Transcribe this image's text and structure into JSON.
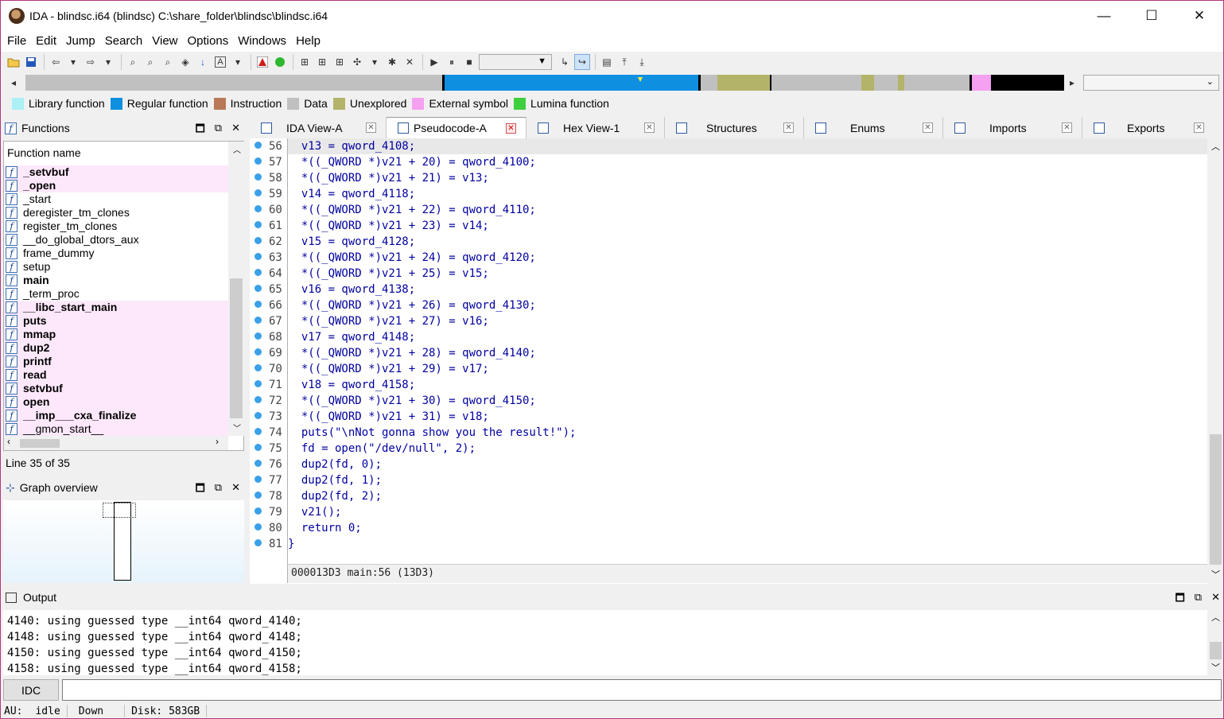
{
  "window": {
    "title": "IDA - blindsc.i64 (blindsc) C:\\share_folder\\blindsc\\blindsc.i64",
    "minimize": "—",
    "maximize": "☐",
    "close": "✕"
  },
  "menu": [
    "File",
    "Edit",
    "Jump",
    "Search",
    "View",
    "Options",
    "Windows",
    "Help"
  ],
  "legend": [
    {
      "label": "Library function",
      "color": "#aaf0f5"
    },
    {
      "label": "Regular function",
      "color": "#0e8fe0"
    },
    {
      "label": "Instruction",
      "color": "#b97956"
    },
    {
      "label": "Data",
      "color": "#c0c0c0"
    },
    {
      "label": "Unexplored",
      "color": "#b3b46a"
    },
    {
      "label": "External symbol",
      "color": "#f5a0f0"
    },
    {
      "label": "Lumina function",
      "color": "#3ecf3e"
    }
  ],
  "functions": {
    "title": "Functions",
    "header": "Function name",
    "items": [
      {
        "name": "_setvbuf",
        "bold": true,
        "pink": true
      },
      {
        "name": "_open",
        "bold": true,
        "pink": true
      },
      {
        "name": "_start",
        "bold": false,
        "pink": false
      },
      {
        "name": "deregister_tm_clones",
        "bold": false,
        "pink": false
      },
      {
        "name": "register_tm_clones",
        "bold": false,
        "pink": false
      },
      {
        "name": "__do_global_dtors_aux",
        "bold": false,
        "pink": false
      },
      {
        "name": "frame_dummy",
        "bold": false,
        "pink": false
      },
      {
        "name": "setup",
        "bold": false,
        "pink": false
      },
      {
        "name": "main",
        "bold": true,
        "pink": false
      },
      {
        "name": "_term_proc",
        "bold": false,
        "pink": false
      },
      {
        "name": "__libc_start_main",
        "bold": true,
        "pink": true
      },
      {
        "name": "puts",
        "bold": true,
        "pink": true
      },
      {
        "name": "mmap",
        "bold": true,
        "pink": true
      },
      {
        "name": "dup2",
        "bold": true,
        "pink": true
      },
      {
        "name": "printf",
        "bold": true,
        "pink": true
      },
      {
        "name": "read",
        "bold": true,
        "pink": true
      },
      {
        "name": "setvbuf",
        "bold": true,
        "pink": true
      },
      {
        "name": "open",
        "bold": true,
        "pink": true
      },
      {
        "name": "__imp___cxa_finalize",
        "bold": true,
        "pink": true
      },
      {
        "name": "__gmon_start__",
        "bold": false,
        "pink": true
      }
    ],
    "status": "Line 35 of 35"
  },
  "graph_overview": {
    "title": "Graph overview"
  },
  "tabs": [
    {
      "label": "IDA View-A",
      "active": false
    },
    {
      "label": "Pseudocode-A",
      "active": true
    },
    {
      "label": "Hex View-1",
      "active": false
    },
    {
      "label": "Structures",
      "active": false
    },
    {
      "label": "Enums",
      "active": false
    },
    {
      "label": "Imports",
      "active": false
    },
    {
      "label": "Exports",
      "active": false
    }
  ],
  "code": {
    "lines": [
      {
        "n": "56",
        "text": "  v13 = qword_4108;"
      },
      {
        "n": "57",
        "text": "  *((_QWORD *)v21 + 20) = qword_4100;"
      },
      {
        "n": "58",
        "text": "  *((_QWORD *)v21 + 21) = v13;"
      },
      {
        "n": "59",
        "text": "  v14 = qword_4118;"
      },
      {
        "n": "60",
        "text": "  *((_QWORD *)v21 + 22) = qword_4110;"
      },
      {
        "n": "61",
        "text": "  *((_QWORD *)v21 + 23) = v14;"
      },
      {
        "n": "62",
        "text": "  v15 = qword_4128;"
      },
      {
        "n": "63",
        "text": "  *((_QWORD *)v21 + 24) = qword_4120;"
      },
      {
        "n": "64",
        "text": "  *((_QWORD *)v21 + 25) = v15;"
      },
      {
        "n": "65",
        "text": "  v16 = qword_4138;"
      },
      {
        "n": "66",
        "text": "  *((_QWORD *)v21 + 26) = qword_4130;"
      },
      {
        "n": "67",
        "text": "  *((_QWORD *)v21 + 27) = v16;"
      },
      {
        "n": "68",
        "text": "  v17 = qword_4148;"
      },
      {
        "n": "69",
        "text": "  *((_QWORD *)v21 + 28) = qword_4140;"
      },
      {
        "n": "70",
        "text": "  *((_QWORD *)v21 + 29) = v17;"
      },
      {
        "n": "71",
        "text": "  v18 = qword_4158;"
      },
      {
        "n": "72",
        "text": "  *((_QWORD *)v21 + 30) = qword_4150;"
      },
      {
        "n": "73",
        "text": "  *((_QWORD *)v21 + 31) = v18;"
      },
      {
        "n": "74",
        "text": "  puts(\"\\nNot gonna show you the result!\");"
      },
      {
        "n": "75",
        "text": "  fd = open(\"/dev/null\", 2);"
      },
      {
        "n": "76",
        "text": "  dup2(fd, 0);"
      },
      {
        "n": "77",
        "text": "  dup2(fd, 1);"
      },
      {
        "n": "78",
        "text": "  dup2(fd, 2);"
      },
      {
        "n": "79",
        "text": "  v21();"
      },
      {
        "n": "80",
        "text": "  return 0;"
      },
      {
        "n": "81",
        "text": "}"
      }
    ],
    "status": "000013D3 main:56 (13D3)"
  },
  "output": {
    "title": "Output",
    "lines": [
      "4140: using guessed type __int64 qword_4140;",
      "4148: using guessed type __int64 qword_4148;",
      "4150: using guessed type __int64 qword_4150;",
      "4158: using guessed type __int64 qword_4158;"
    ]
  },
  "command": {
    "button": "IDC",
    "value": ""
  },
  "statusbar": {
    "au": "AU:",
    "state": "idle",
    "direction": "Down",
    "disk": "Disk: 583GB"
  }
}
